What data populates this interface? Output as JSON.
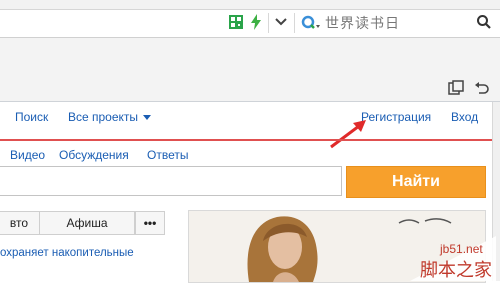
{
  "browser": {
    "search_engine_text": "世界读书日"
  },
  "nav": {
    "items": [
      "Поиск",
      "Все проекты"
    ],
    "register": "Регистрация",
    "login": "Вход"
  },
  "subnav": {
    "items": [
      "Видео",
      "Обсуждения",
      "Ответы"
    ]
  },
  "search": {
    "button_label": "Найти"
  },
  "tabs": {
    "first": "вто",
    "second": "Афиша",
    "more": "•••"
  },
  "news": {
    "snippet": "охраняет накопительные"
  },
  "watermark": {
    "site": "jb51.net",
    "name": "脚本之家"
  },
  "colors": {
    "link": "#1a5db3",
    "accent_button": "#f7a02c",
    "divider": "#e05050",
    "arrow": "#e02a2a"
  }
}
